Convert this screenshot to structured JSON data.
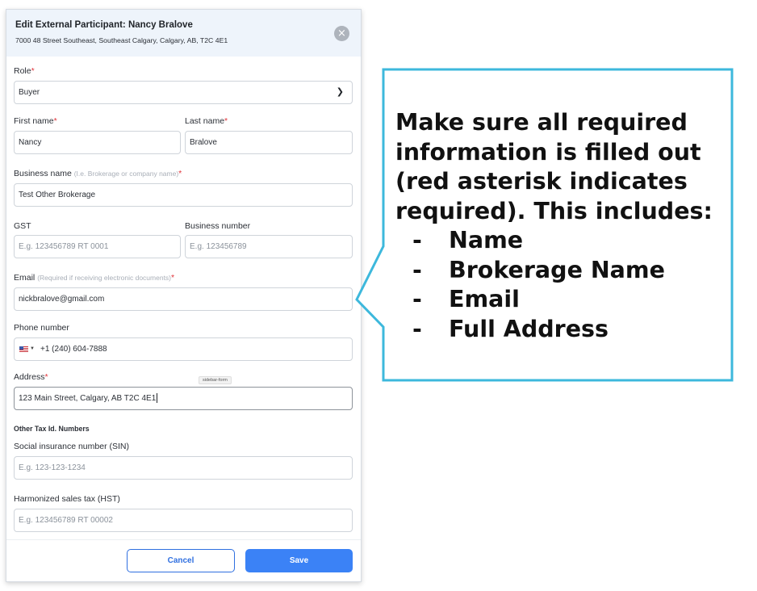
{
  "dialog": {
    "title": "Edit External Participant: Nancy Bralove",
    "subtitle": "7000 48 Street Southeast, Southeast Calgary, Calgary, AB, T2C 4E1",
    "close_icon": "×"
  },
  "form": {
    "role": {
      "label": "Role",
      "value": "Buyer"
    },
    "first_name": {
      "label": "First name",
      "value": "Nancy"
    },
    "last_name": {
      "label": "Last name",
      "value": "Bralove"
    },
    "business_name": {
      "label": "Business name",
      "hint": "(I.e. Brokerage or company name)",
      "value": "Test Other Brokerage"
    },
    "gst": {
      "label": "GST",
      "placeholder": "E.g. 123456789 RT 0001"
    },
    "business_number": {
      "label": "Business number",
      "placeholder": "E.g. 123456789"
    },
    "email": {
      "label": "Email",
      "hint": "(Required if receiving electronic documents)",
      "value": "nickbralove@gmail.com"
    },
    "phone": {
      "label": "Phone number",
      "country_icon": "us-flag-icon",
      "value": "+1 (240) 604-7888"
    },
    "address": {
      "label": "Address",
      "value": "123 Main Street, Calgary, AB T2C 4E1"
    },
    "tooltip": "sidebar-form",
    "other_tax_heading": "Other Tax Id. Numbers",
    "sin": {
      "label": "Social insurance number (SIN)",
      "placeholder": "E.g. 123-123-1234"
    },
    "hst": {
      "label": "Harmonized sales tax (HST)",
      "placeholder": "E.g. 123456789 RT 00002"
    },
    "required_marker": "*"
  },
  "footer": {
    "cancel_label": "Cancel",
    "save_label": "Save"
  },
  "callout": {
    "text": "Make sure all required information is filled out (red asterisk indicates required). This includes:",
    "items": [
      "Name",
      "Brokerage Name",
      "Email",
      "Full Address"
    ],
    "bullet": "-",
    "border_color": "#3db8dc"
  },
  "colors": {
    "primary": "#3b82f6",
    "required": "#e0353b",
    "header_bg": "#eef4fb"
  }
}
